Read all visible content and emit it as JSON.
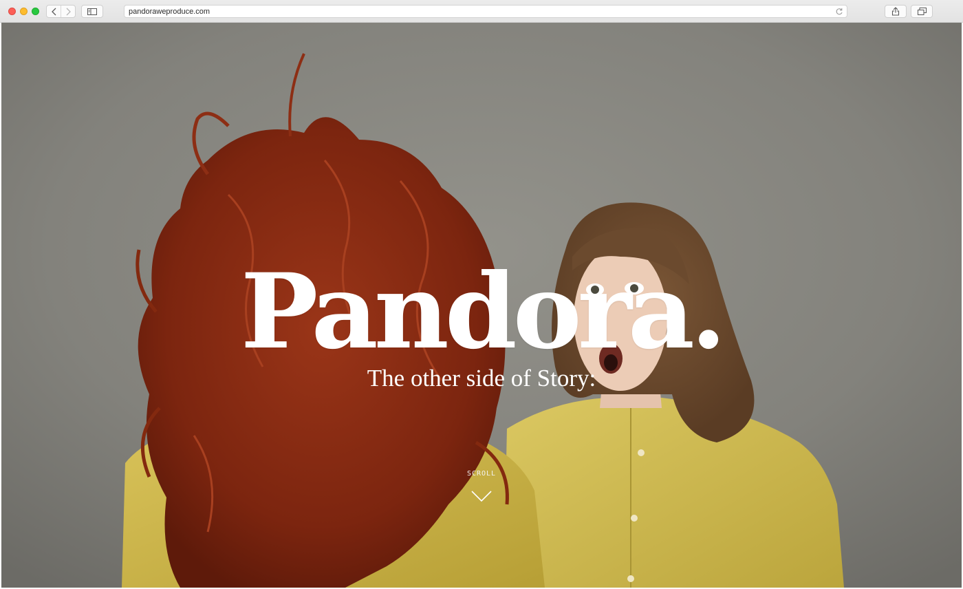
{
  "browser": {
    "url": "pandoraweproduce.com",
    "icons": [
      "back-icon",
      "forward-icon",
      "sidebar-icon",
      "reload-icon",
      "share-icon",
      "tabs-icon"
    ]
  },
  "hero": {
    "title": "Pandora.",
    "subtitle": "The other side of Story:",
    "scroll_label": "SCROLL",
    "scroll_icon": "chevron-down-icon"
  },
  "colors": {
    "background": "#84837d",
    "hair": "#8a2a12",
    "shirt": "#d8c24e",
    "text": "#ffffff"
  }
}
